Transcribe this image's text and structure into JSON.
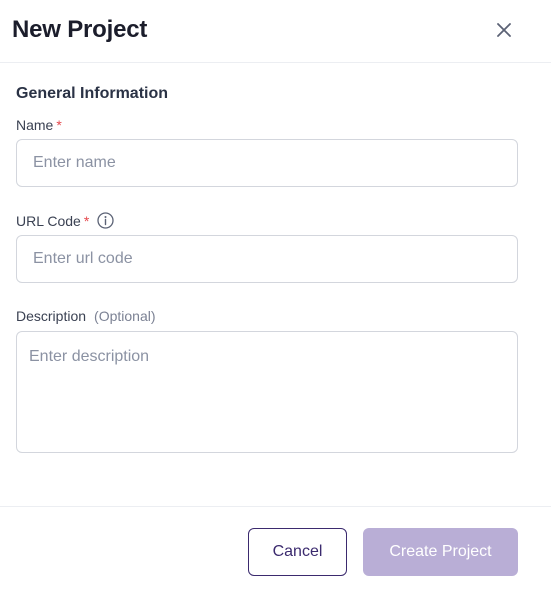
{
  "modal": {
    "title": "New Project",
    "close_icon": "close-icon"
  },
  "form": {
    "section_title": "General Information",
    "name": {
      "label": "Name",
      "required_mark": "*",
      "placeholder": "Enter name",
      "value": ""
    },
    "url_code": {
      "label": "URL Code",
      "required_mark": "*",
      "info_icon": "info-icon",
      "placeholder": "Enter url code",
      "value": ""
    },
    "description": {
      "label": "Description",
      "optional_text": "(Optional)",
      "placeholder": "Enter description",
      "value": ""
    }
  },
  "footer": {
    "cancel_label": "Cancel",
    "create_label": "Create Project",
    "create_enabled": false
  },
  "colors": {
    "primary": "#3b2a6e",
    "primary_disabled": "#b9aed6",
    "required": "#e5484d",
    "border": "#d3d6dd"
  }
}
